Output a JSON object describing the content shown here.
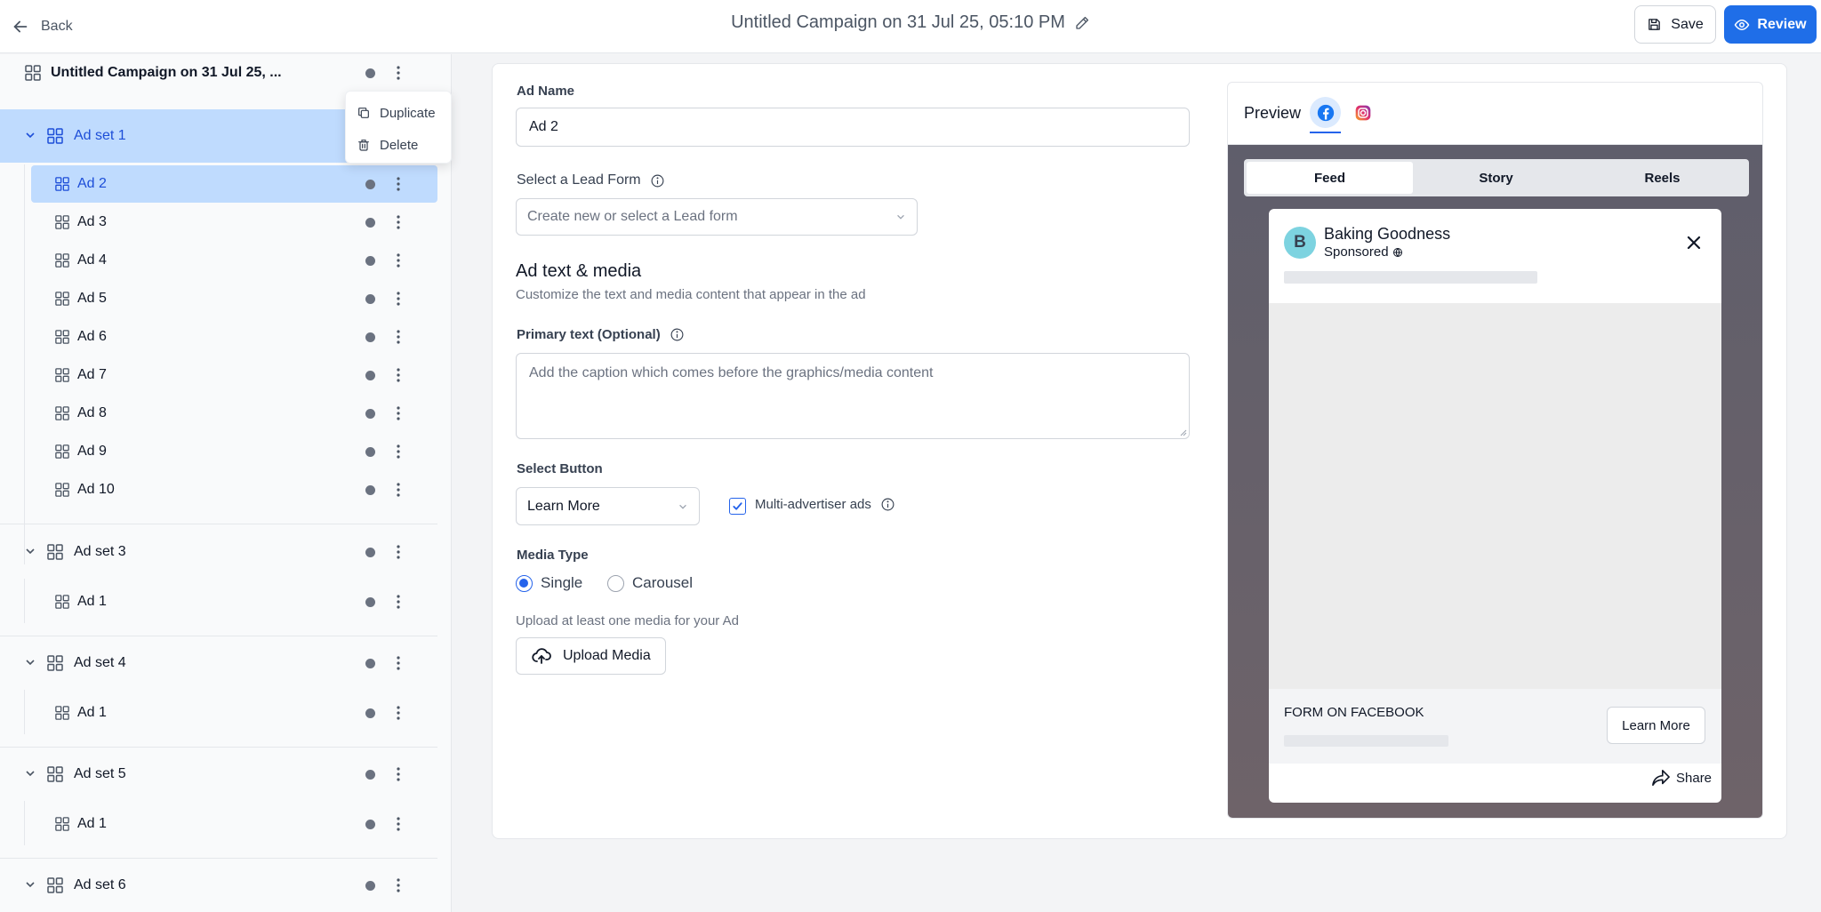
{
  "header": {
    "back_label": "Back",
    "campaign_title": "Untitled Campaign on 31 Jul 25, 05:10 PM",
    "save_label": "Save",
    "review_label": "Review"
  },
  "sidebar": {
    "campaign_label": "Untitled Campaign on 31 Jul 25, ...",
    "context_menu": {
      "duplicate": "Duplicate",
      "delete": "Delete"
    },
    "adsets": [
      {
        "label": "Ad set 1",
        "ads": [
          "Ad 2",
          "Ad 3",
          "Ad 4",
          "Ad 5",
          "Ad 6",
          "Ad 7",
          "Ad 8",
          "Ad 9",
          "Ad 10"
        ]
      },
      {
        "label": "Ad set 3",
        "ads": [
          "Ad 1"
        ]
      },
      {
        "label": "Ad set 4",
        "ads": [
          "Ad 1"
        ]
      },
      {
        "label": "Ad set 5",
        "ads": [
          "Ad 1"
        ]
      },
      {
        "label": "Ad set 6",
        "ads": []
      }
    ]
  },
  "form": {
    "ad_name_label": "Ad Name",
    "ad_name_value": "Ad 2",
    "lead_form_label": "Select a Lead Form",
    "lead_form_placeholder": "Create new or select a Lead form",
    "section_title": "Ad text & media",
    "section_subtitle": "Customize the text and media content that appear in the ad",
    "primary_text_label": "Primary text (Optional)",
    "primary_text_placeholder": "Add the caption which comes before the graphics/media content",
    "select_button_label": "Select Button",
    "select_button_value": "Learn More",
    "multi_advertiser_label": "Multi-advertiser ads",
    "media_type_label": "Media Type",
    "media_type_options": [
      "Single",
      "Carousel"
    ],
    "media_type_selected": "Single",
    "upload_hint": "Upload at least one media for your Ad",
    "upload_button": "Upload Media"
  },
  "preview": {
    "title": "Preview",
    "platforms": [
      "facebook-icon",
      "instagram-icon"
    ],
    "tabs": [
      "Feed",
      "Story",
      "Reels"
    ],
    "active_tab": "Feed",
    "post": {
      "avatar_letter": "B",
      "page_name": "Baking Goodness",
      "sponsored": "Sponsored",
      "form_label": "FORM ON FACEBOOK",
      "cta_label": "Learn More",
      "share_label": "Share"
    }
  },
  "colors": {
    "accent": "#1f6ee8",
    "selected_bg": "#bfdbfe",
    "preview_stage": "#5f5e6b"
  }
}
